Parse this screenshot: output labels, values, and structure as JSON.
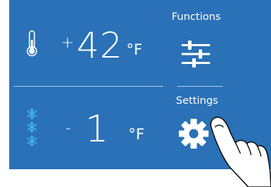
{
  "fridge": {
    "sign": "+",
    "value": "42",
    "unit": "°F",
    "icon": "thermometer-icon"
  },
  "freezer": {
    "sign": "-",
    "value": "1",
    "unit": "°F",
    "icon": "snowflake-stack-icon"
  },
  "functions": {
    "label": "Functions",
    "icon": "sliders-icon"
  },
  "settings": {
    "label": "Settings",
    "icon": "gear-icon"
  },
  "colors": {
    "panel_bg": "#2a71b7",
    "text": "#ffffff"
  }
}
